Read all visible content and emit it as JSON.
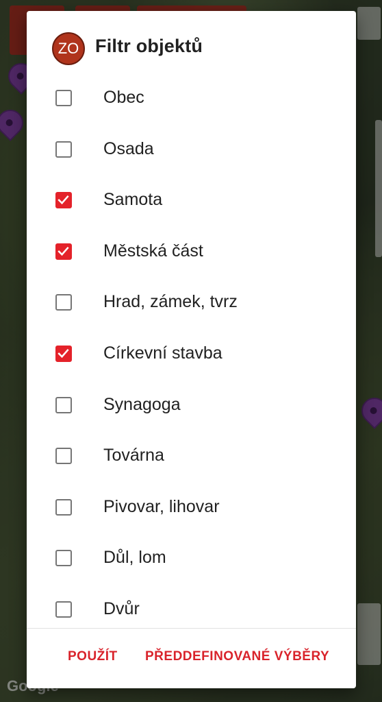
{
  "dialog": {
    "app_badge": "ZO",
    "title": "Filtr objektů"
  },
  "filters": [
    {
      "label": "Obec",
      "checked": false
    },
    {
      "label": "Osada",
      "checked": false
    },
    {
      "label": "Samota",
      "checked": true
    },
    {
      "label": "Městská část",
      "checked": true
    },
    {
      "label": "Hrad, zámek, tvrz",
      "checked": false
    },
    {
      "label": "Církevní stavba",
      "checked": true
    },
    {
      "label": "Synagoga",
      "checked": false
    },
    {
      "label": "Továrna",
      "checked": false
    },
    {
      "label": "Pivovar, lihovar",
      "checked": false
    },
    {
      "label": "Důl, lom",
      "checked": false
    },
    {
      "label": "Dvůr",
      "checked": false
    }
  ],
  "actions": {
    "apply_label": "POUŽÍT",
    "presets_label": "PŘEDDEFINOVANÉ VÝBĚRY"
  },
  "map": {
    "attribution": "Google"
  },
  "colors": {
    "accent": "#e4222a",
    "button_text": "#d9232b",
    "avatar": "#b0341c",
    "pin": "#7a3d9a"
  }
}
